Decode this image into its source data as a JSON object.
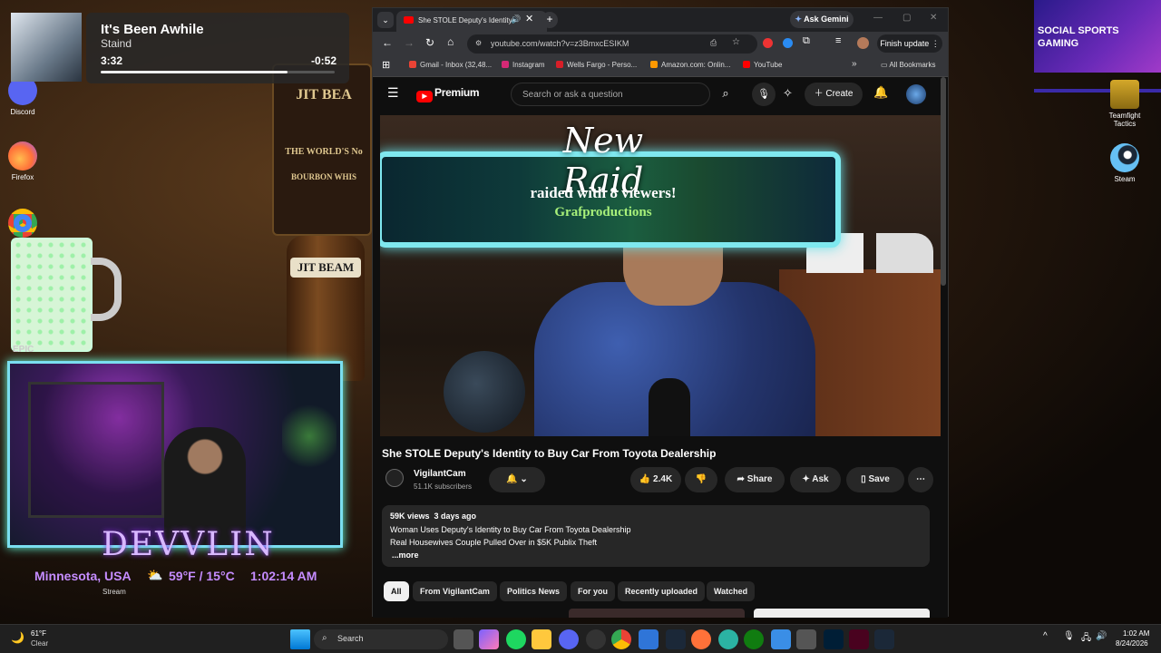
{
  "music": {
    "title": "It's Been Awhile",
    "artist": "Staind",
    "elapsed": "3:32",
    "remaining": "-0:52",
    "progress": 0.8
  },
  "desktop_icons": {
    "discord": "Discord",
    "firefox": "Firefox",
    "teamfight": "Teamfight Tactics",
    "steam": "Steam"
  },
  "bottles": {
    "label1": "THE WORLD'S No",
    "label2": "BOURBON WHIS",
    "jitbeam": "JIT BEAM",
    "jitbeam2": "JIT BEA"
  },
  "mug_label": "EPIC",
  "promo": {
    "line1": "SOCIAL SPORTS",
    "line2": "GAMING"
  },
  "browser": {
    "tab_title": "She STOLE Deputy's Identity",
    "ask_gemini": "Ask Gemini",
    "url": "youtube.com/watch?v=z3BmxcESIKM",
    "finish_update": "Finish update",
    "bookmarks": [
      "Gmail - Inbox (32,48...",
      "Instagram",
      "Wells Fargo - Perso...",
      "Amazon.com: Onlin...",
      "YouTube"
    ],
    "all_bookmarks": "All Bookmarks"
  },
  "youtube": {
    "logo": "Premium",
    "search_placeholder": "Search or ask a question",
    "create": "Create",
    "raid_title": "New Raid",
    "raid_text": "raided with 8 viewers!",
    "raid_user": "Grafproductions",
    "video_title": "She STOLE Deputy's Identity to Buy Car From Toyota Dealership",
    "channel": "VigilantCam",
    "subscribers": "51.1K subscribers",
    "likes": "2.4K",
    "share": "Share",
    "ask": "Ask",
    "save": "Save",
    "views_date": "59K views  3 days ago",
    "desc1": "Woman Uses Deputy's Identity to Buy Car From Toyota Dealership",
    "desc2": "Real Housewives Couple Pulled Over in $5K Publix Theft",
    "more": "...more",
    "chips": [
      "All",
      "From VigilantCam",
      "Politics News",
      "For you",
      "Recently uploaded",
      "Watched"
    ]
  },
  "overlay": {
    "name": "DEVVLIN",
    "location": "Minnesota, USA",
    "weather": "59°F / 15°C",
    "time": "1:02:14 AM",
    "stream": "Stream"
  },
  "taskbar": {
    "temp": "61°F",
    "cond": "Clear",
    "search": "Search",
    "clock": "1:02 AM",
    "date": "8/24/2026"
  },
  "colors": {
    "yt_red": "#ff0000",
    "raid_border": "#7fe8ef",
    "overlay_purple": "#c58cff"
  }
}
